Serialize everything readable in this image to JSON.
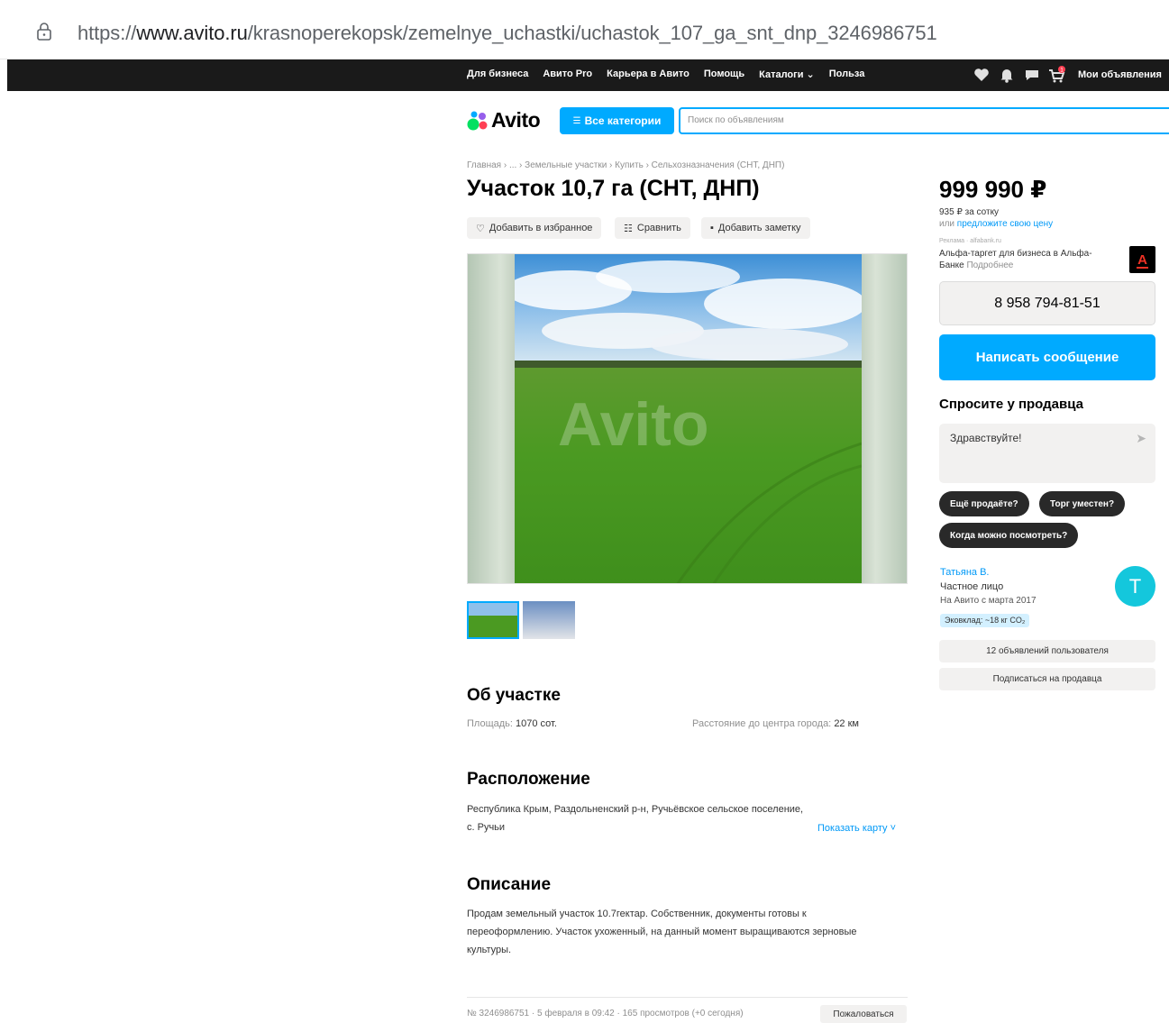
{
  "browser": {
    "url_prefix": "https://",
    "url_domain": "www.avito.ru",
    "url_path": "/krasnoperekopsk/zemelnye_uchastki/uchastok_107_ga_snt_dnp_3246986751"
  },
  "topnav": {
    "links": [
      "Для бизнеса",
      "Авито Pro",
      "Карьера в Авито",
      "Помощь",
      "Каталоги ⌄",
      "Польза"
    ],
    "cart_badge": "1",
    "my_ads": "Мои объявления"
  },
  "header": {
    "logo": "Avito",
    "categories_button": "Все категории",
    "search_placeholder": "Поиск по объявлениям"
  },
  "breadcrumb": "Главная › ... › Земельные участки › Купить › Сельхозназначения (СНТ, ДНП)",
  "title": "Участок 10,7 га (СНТ, ДНП)",
  "actions": {
    "favorite": "Добавить в избранное",
    "compare": "Сравнить",
    "note": "Добавить заметку"
  },
  "gallery": {
    "watermark": "Avito"
  },
  "about": {
    "heading": "Об участке",
    "area_label": "Площадь:",
    "area_value": "1070 сот.",
    "distance_label": "Расстояние до центра города:",
    "distance_value": "22 км"
  },
  "location": {
    "heading": "Расположение",
    "address": "Республика Крым, Раздольненский р-н, Ручьёвское сельское поселение, с. Ручьи",
    "show_map": "Показать карту ˅"
  },
  "description": {
    "heading": "Описание",
    "text": "Продам земельный участок 10.7гектар. Собственник, документы готовы к переоформлению. Участок ухоженный, на данный момент выращиваются зерновые культуры."
  },
  "footer": {
    "meta": "№ 3246986751 · 5 февраля в 09:42 · 165 просмотров (+0 сегодня)",
    "complain": "Пожаловаться"
  },
  "sidebar": {
    "price": "999 990 ₽",
    "per_sotka": "935 ₽ за сотку",
    "offer_prefix": "или ",
    "offer_link": "предложите свою цену",
    "ad_label": "Реклама · alfabank.ru",
    "ad_text": "Альфа-таргет для бизнеса в Альфа-Банке ",
    "ad_more": "Подробнее",
    "alfa_letter": "А",
    "phone": "8 958 794-81-51",
    "write_button": "Написать сообщение",
    "ask_title": "Спросите у продавца",
    "ask_placeholder": "Здравствуйте!",
    "chips": [
      "Ещё продаёте?",
      "Торг уместен?",
      "Когда можно посмотреть?"
    ],
    "seller_name": "Татьяна В.",
    "seller_type": "Частное лицо",
    "seller_since": "На Авито с марта 2017",
    "eco": "Эковклад: ~18 кг CO₂",
    "avatar_letter": "T",
    "user_ads": "12 объявлений пользователя",
    "subscribe": "Подписаться на продавца"
  },
  "colors": {
    "accent": "#00aaff",
    "dark_nav": "#1a1a1a",
    "chip": "#292929",
    "avatar": "#14c7dc"
  }
}
